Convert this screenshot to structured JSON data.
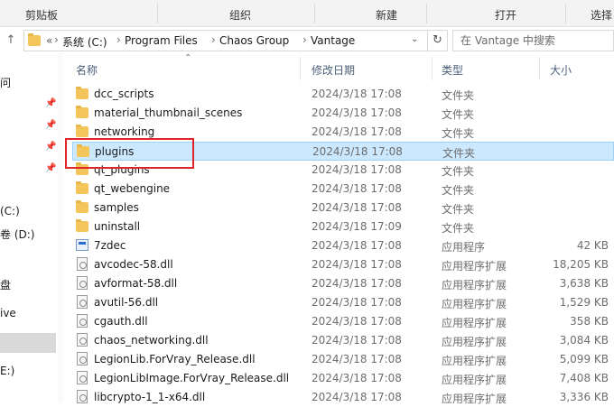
{
  "ribbon": {
    "clipboard": "剪贴板",
    "organize": "组织",
    "new": "新建",
    "open": "打开",
    "select": "选择"
  },
  "address": {
    "overflow": "«",
    "crumbs": [
      "系统 (C:)",
      "Program Files",
      "Chaos Group",
      "Vantage"
    ],
    "search_placeholder": "在 Vantage 中搜索"
  },
  "left_nav": {
    "items": [
      "问",
      "(C:)",
      "卷 (D:)",
      "盘",
      "ive",
      "E:)"
    ]
  },
  "columns": {
    "name": "名称",
    "date": "修改日期",
    "type": "类型",
    "size": "大小"
  },
  "files": [
    {
      "name": "dcc_scripts",
      "date": "2024/3/18 17:08",
      "type": "文件夹",
      "size": "",
      "icon": "folder-icon"
    },
    {
      "name": "material_thumbnail_scenes",
      "date": "2024/3/18 17:08",
      "type": "文件夹",
      "size": "",
      "icon": "folder-icon"
    },
    {
      "name": "networking",
      "date": "2024/3/18 17:08",
      "type": "文件夹",
      "size": "",
      "icon": "folder-icon"
    },
    {
      "name": "plugins",
      "date": "2024/3/18 17:08",
      "type": "文件夹",
      "size": "",
      "icon": "folder-icon",
      "selected": true
    },
    {
      "name": "qt_plugins",
      "date": "2024/3/18 17:08",
      "type": "文件夹",
      "size": "",
      "icon": "folder-icon"
    },
    {
      "name": "qt_webengine",
      "date": "2024/3/18 17:08",
      "type": "文件夹",
      "size": "",
      "icon": "folder-icon"
    },
    {
      "name": "samples",
      "date": "2024/3/18 17:08",
      "type": "文件夹",
      "size": "",
      "icon": "folder-icon"
    },
    {
      "name": "uninstall",
      "date": "2024/3/18 17:09",
      "type": "文件夹",
      "size": "",
      "icon": "folder-icon"
    },
    {
      "name": "7zdec",
      "date": "2024/3/18 17:08",
      "type": "应用程序",
      "size": "42 KB",
      "icon": "exe-icon"
    },
    {
      "name": "avcodec-58.dll",
      "date": "2024/3/18 17:08",
      "type": "应用程序扩展",
      "size": "18,205 KB",
      "icon": "dll-icon"
    },
    {
      "name": "avformat-58.dll",
      "date": "2024/3/18 17:08",
      "type": "应用程序扩展",
      "size": "3,638 KB",
      "icon": "dll-icon"
    },
    {
      "name": "avutil-56.dll",
      "date": "2024/3/18 17:08",
      "type": "应用程序扩展",
      "size": "1,529 KB",
      "icon": "dll-icon"
    },
    {
      "name": "cgauth.dll",
      "date": "2024/3/18 17:08",
      "type": "应用程序扩展",
      "size": "358 KB",
      "icon": "dll-icon"
    },
    {
      "name": "chaos_networking.dll",
      "date": "2024/3/18 17:08",
      "type": "应用程序扩展",
      "size": "3,084 KB",
      "icon": "dll-icon"
    },
    {
      "name": "LegionLib.ForVray_Release.dll",
      "date": "2024/3/18 17:08",
      "type": "应用程序扩展",
      "size": "5,099 KB",
      "icon": "dll-icon"
    },
    {
      "name": "LegionLibImage.ForVray_Release.dll",
      "date": "2024/3/18 17:08",
      "type": "应用程序扩展",
      "size": "7,408 KB",
      "icon": "dll-icon"
    },
    {
      "name": "libcrypto-1_1-x64.dll",
      "date": "2024/3/18 17:08",
      "type": "应用程序扩展",
      "size": "3,336 KB",
      "icon": "dll-icon"
    }
  ],
  "colors": {
    "selection_bg": "#cce8ff",
    "selection_border": "#99d1ff",
    "highlight_box": "#e0252a",
    "folder": "#f4c55a"
  }
}
